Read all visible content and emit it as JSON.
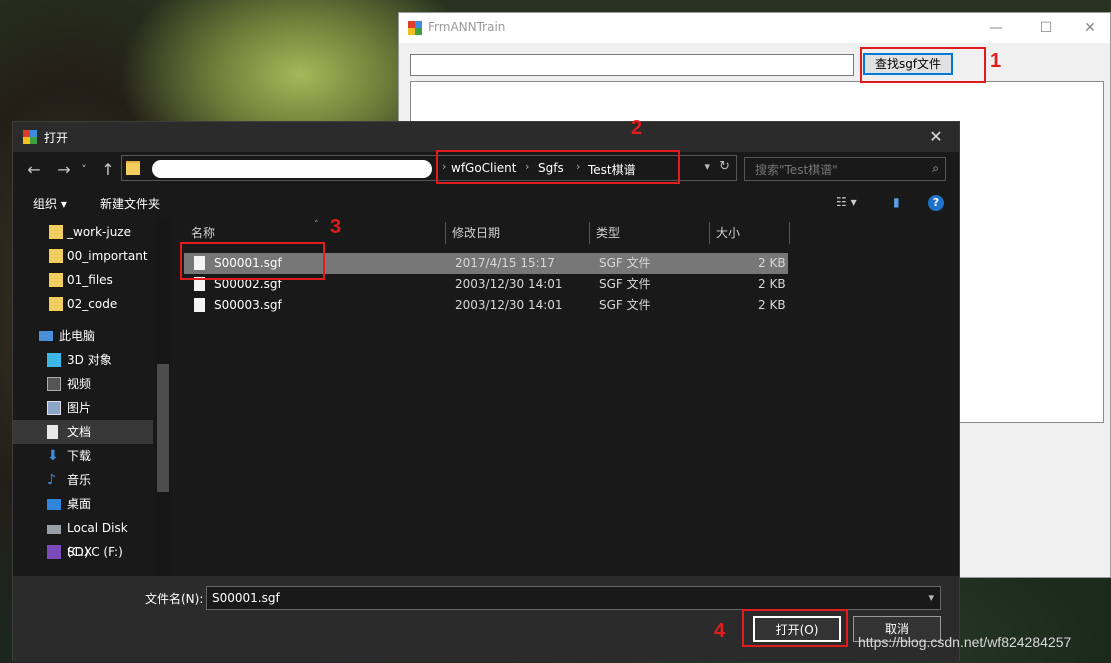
{
  "form": {
    "title": "FrmANNTrain",
    "minimize": "—",
    "maximize": "☐",
    "close": "✕",
    "path_value": "",
    "browse_label": "查找sgf文件"
  },
  "annotations": [
    "1",
    "2",
    "3",
    "4"
  ],
  "dialog": {
    "title": "打开",
    "close": "✕",
    "nav": {
      "back": "←",
      "forward": "→",
      "recent": "˅",
      "up": "↑"
    },
    "breadcrumb": [
      "wfGoClient",
      "Sgfs",
      "Test棋谱"
    ],
    "breadcrumb_sep": "›",
    "search_placeholder": "搜索\"Test棋谱\"",
    "toolbar": {
      "organize": "组织 ▾",
      "new_folder": "新建文件夹",
      "view": "☷ ▾",
      "preview": "▮",
      "help": "?"
    },
    "sidebar": [
      {
        "label": "_work-juze",
        "icon": "folder-icon"
      },
      {
        "label": "00_important",
        "icon": "folder-icon"
      },
      {
        "label": "01_files",
        "icon": "folder-icon"
      },
      {
        "label": "02_code",
        "icon": "folder-icon"
      },
      {
        "label": "此电脑",
        "icon": "computer-icon"
      },
      {
        "label": "3D 对象",
        "icon": "cube-icon"
      },
      {
        "label": "视频",
        "icon": "video-icon"
      },
      {
        "label": "图片",
        "icon": "picture-icon"
      },
      {
        "label": "文档",
        "icon": "document-icon"
      },
      {
        "label": "下载",
        "icon": "download-icon"
      },
      {
        "label": "音乐",
        "icon": "music-icon"
      },
      {
        "label": "桌面",
        "icon": "desktop-icon"
      },
      {
        "label": "Local Disk (C:)",
        "icon": "drive-icon"
      },
      {
        "label": "SDXC (F:)",
        "icon": "sd-card-icon"
      }
    ],
    "columns": [
      "名称",
      "修改日期",
      "类型",
      "大小"
    ],
    "files": [
      {
        "name": "S00001.sgf",
        "date": "2017/4/15 15:17",
        "type": "SGF 文件",
        "size": "2 KB",
        "selected": true
      },
      {
        "name": "S00002.sgf",
        "date": "2003/12/30 14:01",
        "type": "SGF 文件",
        "size": "2 KB",
        "selected": false
      },
      {
        "name": "S00003.sgf",
        "date": "2003/12/30 14:01",
        "type": "SGF 文件",
        "size": "2 KB",
        "selected": false
      }
    ],
    "filename_label": "文件名(N):",
    "filename_value": "S00001.sgf",
    "open_label": "打开(O)",
    "cancel_label": "取消"
  },
  "watermark": "https://blog.csdn.net/wf824284257",
  "colors": {
    "annotation_red": "#e01c1c",
    "selection": "#777777",
    "dialog_bg": "#191919"
  }
}
